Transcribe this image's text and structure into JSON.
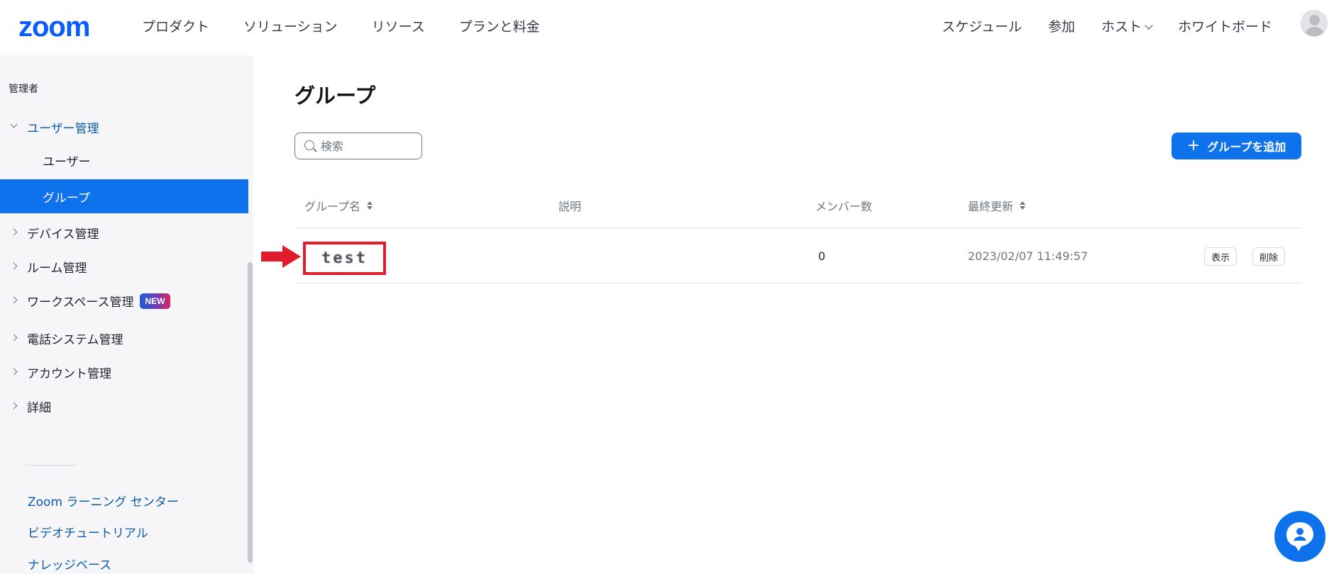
{
  "header": {
    "logo": "zoom",
    "nav_left": [
      "プロダクト",
      "ソリューション",
      "リソース",
      "プランと料金"
    ],
    "nav_right": {
      "schedule": "スケジュール",
      "join": "参加",
      "host": "ホスト",
      "whiteboard": "ホワイトボード"
    }
  },
  "sidebar": {
    "heading": "管理者",
    "user_management": "ユーザー管理",
    "users": "ユーザー",
    "groups": "グループ",
    "device_management": "デバイス管理",
    "room_management": "ルーム管理",
    "workspace_management": "ワークスペース管理",
    "new_badge": "NEW",
    "phone_system_management": "電話システム管理",
    "account_management": "アカウント管理",
    "advanced": "詳細",
    "links": {
      "learning_center": "Zoom ラーニング センター",
      "video_tutorials": "ビデオチュートリアル",
      "knowledge_base": "ナレッジベース"
    }
  },
  "main": {
    "title": "グループ",
    "search_placeholder": "検索",
    "add_group_label": "グループを追加",
    "columns": {
      "group_name": "グループ名",
      "description": "説明",
      "member_count": "メンバー数",
      "last_updated": "最終更新"
    },
    "rows": [
      {
        "name": "test",
        "description": "",
        "members": "0",
        "updated": "2023/02/07 11:49:57",
        "view_label": "表示",
        "delete_label": "削除"
      }
    ]
  },
  "colors": {
    "brand": "#0b5cff",
    "accent": "#0e72ed",
    "highlight": "#e11c2c"
  }
}
